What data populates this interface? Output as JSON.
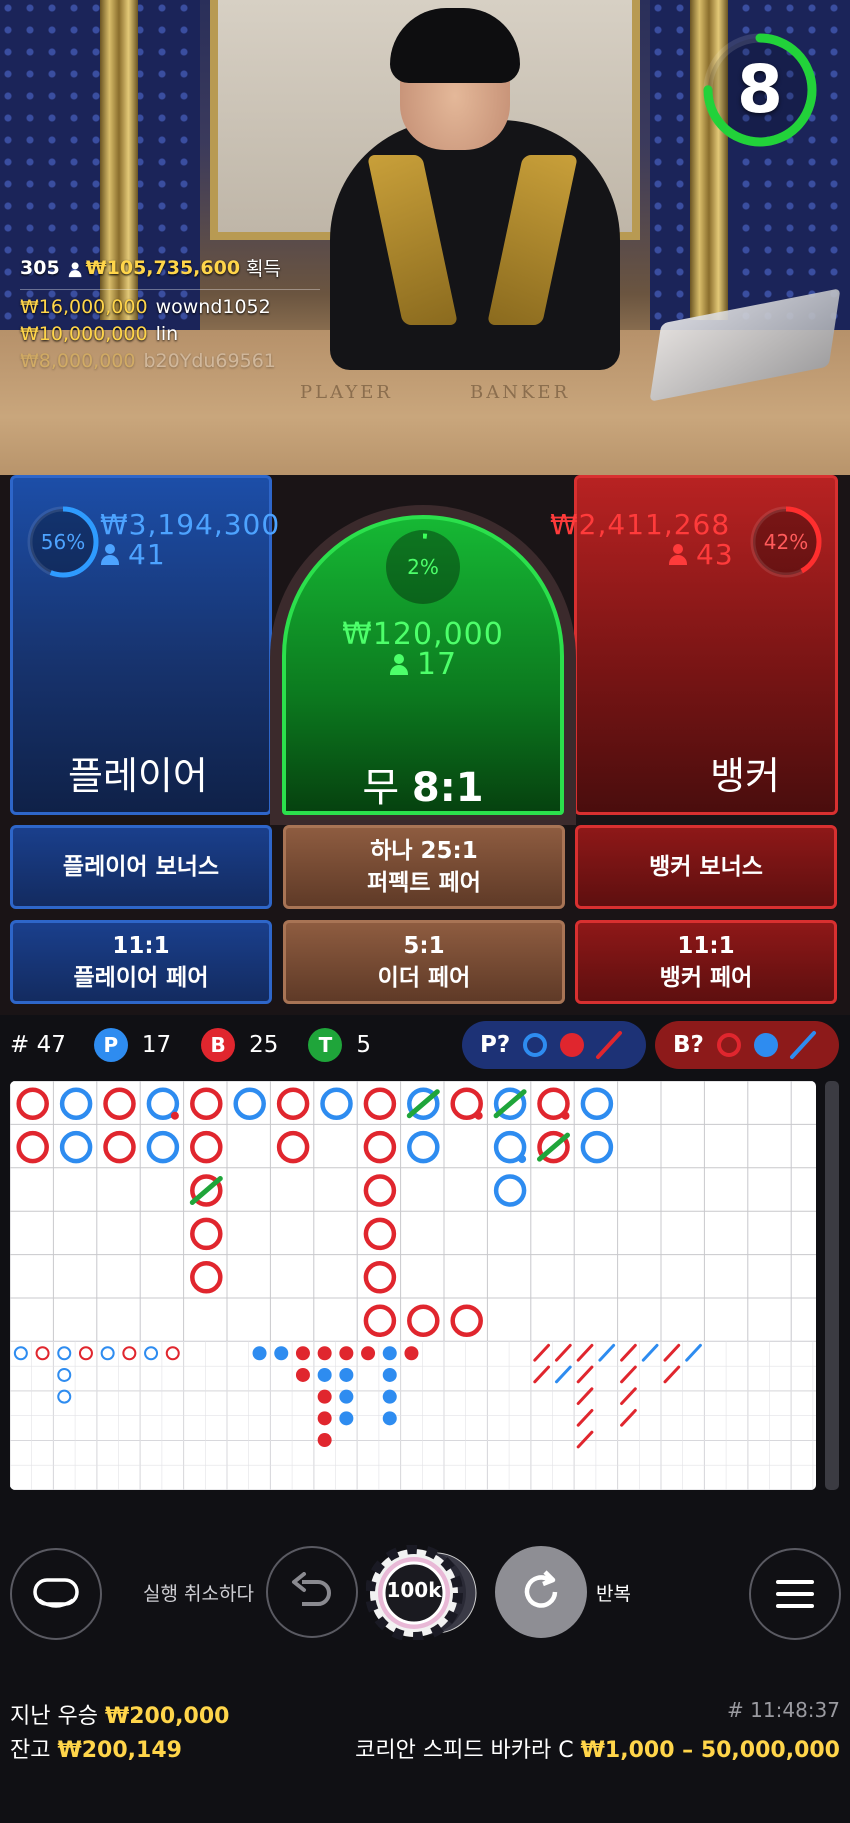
{
  "top_winners": {
    "rank": "305",
    "total": "₩105,735,600",
    "total_label": "획득",
    "rows": [
      {
        "amount": "₩16,000,000",
        "name": "wownd1052"
      },
      {
        "amount": "₩10,000,000",
        "name": "lin"
      },
      {
        "amount": "₩8,000,000",
        "name": "b20Ydu69561"
      }
    ]
  },
  "table_text": {
    "left": "PLAYER",
    "right": "BANKER"
  },
  "timer": {
    "seconds": "8",
    "progress": 0.75,
    "color": "#22d23a"
  },
  "player": {
    "label": "플레이어",
    "amount": "₩3,194,300",
    "users": "41",
    "pct_text": "56%",
    "pct": 0.56,
    "color": "#2e9bff"
  },
  "tie": {
    "label_main": "무",
    "label_odds": "8:1",
    "amount": "₩120,000",
    "users": "17",
    "pct_text": "2%",
    "pct": 0.02,
    "color": "#3cff5a"
  },
  "banker": {
    "label": "뱅커",
    "amount": "₩2,411,268",
    "users": "43",
    "pct_text": "42%",
    "pct": 0.42,
    "color": "#ff2e2e"
  },
  "side_bets": {
    "player_bonus": "플레이어 보너스",
    "perfect_odds": "하나 25:1",
    "perfect_label": "퍼펙트 페어",
    "banker_bonus": "뱅커 보너스",
    "player_pair_odds": "11:1",
    "player_pair_label": "플레이어 페어",
    "either_odds": "5:1",
    "either_label": "이더 페어",
    "banker_pair_odds": "11:1",
    "banker_pair_label": "뱅커 페어"
  },
  "stats": {
    "round": "# 47",
    "p_letter": "P",
    "p_count": "17",
    "b_letter": "B",
    "b_count": "25",
    "t_letter": "T",
    "t_count": "5"
  },
  "predict": {
    "p_label": "P?",
    "b_label": "B?"
  },
  "roadmap": {
    "big_road_cells": [
      {
        "col": 0,
        "row": 0,
        "c": "B"
      },
      {
        "col": 0,
        "row": 1,
        "c": "B"
      },
      {
        "col": 1,
        "row": 0,
        "c": "P"
      },
      {
        "col": 1,
        "row": 1,
        "c": "P"
      },
      {
        "col": 2,
        "row": 0,
        "c": "B"
      },
      {
        "col": 2,
        "row": 1,
        "c": "B"
      },
      {
        "col": 3,
        "row": 0,
        "c": "P",
        "pair": "B"
      },
      {
        "col": 3,
        "row": 1,
        "c": "P"
      },
      {
        "col": 4,
        "row": 0,
        "c": "B"
      },
      {
        "col": 4,
        "row": 1,
        "c": "B"
      },
      {
        "col": 4,
        "row": 2,
        "c": "B",
        "tie": true
      },
      {
        "col": 4,
        "row": 3,
        "c": "B"
      },
      {
        "col": 4,
        "row": 4,
        "c": "B"
      },
      {
        "col": 5,
        "row": 0,
        "c": "P"
      },
      {
        "col": 6,
        "row": 0,
        "c": "B"
      },
      {
        "col": 6,
        "row": 1,
        "c": "B"
      },
      {
        "col": 7,
        "row": 0,
        "c": "P"
      },
      {
        "col": 8,
        "row": 0,
        "c": "B"
      },
      {
        "col": 8,
        "row": 1,
        "c": "B"
      },
      {
        "col": 8,
        "row": 2,
        "c": "B"
      },
      {
        "col": 8,
        "row": 3,
        "c": "B"
      },
      {
        "col": 8,
        "row": 4,
        "c": "B"
      },
      {
        "col": 8,
        "row": 5,
        "c": "B"
      },
      {
        "col": 9,
        "row": 0,
        "c": "P",
        "tie": true
      },
      {
        "col": 9,
        "row": 1,
        "c": "P"
      },
      {
        "col": 9,
        "row": 5,
        "c": "B"
      },
      {
        "col": 10,
        "row": 0,
        "c": "B",
        "pair": "B"
      },
      {
        "col": 10,
        "row": 5,
        "c": "B"
      },
      {
        "col": 11,
        "row": 0,
        "c": "P",
        "tie": true
      },
      {
        "col": 11,
        "row": 1,
        "c": "P",
        "pair": "P"
      },
      {
        "col": 11,
        "row": 2,
        "c": "P"
      },
      {
        "col": 12,
        "row": 0,
        "c": "B",
        "pair": "B"
      },
      {
        "col": 12,
        "row": 1,
        "c": "B",
        "tie": true
      },
      {
        "col": 13,
        "row": 0,
        "c": "P"
      },
      {
        "col": 13,
        "row": 1,
        "c": "P"
      }
    ],
    "big_eye": [
      {
        "col": 0,
        "row": 0,
        "c": "P"
      },
      {
        "col": 1,
        "row": 0,
        "c": "B"
      },
      {
        "col": 2,
        "row": 0,
        "c": "P"
      },
      {
        "col": 2,
        "row": 1,
        "c": "P"
      },
      {
        "col": 2,
        "row": 2,
        "c": "P"
      },
      {
        "col": 3,
        "row": 0,
        "c": "B"
      },
      {
        "col": 4,
        "row": 0,
        "c": "P"
      },
      {
        "col": 5,
        "row": 0,
        "c": "B"
      },
      {
        "col": 6,
        "row": 0,
        "c": "P"
      },
      {
        "col": 7,
        "row": 0,
        "c": "B"
      }
    ],
    "small_road": [
      {
        "col": 0,
        "row": 0,
        "c": "P"
      },
      {
        "col": 1,
        "row": 0,
        "c": "P"
      },
      {
        "col": 2,
        "row": 0,
        "c": "B"
      },
      {
        "col": 2,
        "row": 1,
        "c": "B"
      },
      {
        "col": 3,
        "row": 0,
        "c": "B"
      },
      {
        "col": 3,
        "row": 1,
        "c": "P"
      },
      {
        "col": 3,
        "row": 2,
        "c": "B"
      },
      {
        "col": 3,
        "row": 3,
        "c": "B"
      },
      {
        "col": 3,
        "row": 4,
        "c": "B"
      },
      {
        "col": 4,
        "row": 0,
        "c": "B"
      },
      {
        "col": 4,
        "row": 1,
        "c": "P"
      },
      {
        "col": 4,
        "row": 2,
        "c": "P"
      },
      {
        "col": 4,
        "row": 3,
        "c": "P"
      },
      {
        "col": 5,
        "row": 0,
        "c": "B"
      },
      {
        "col": 6,
        "row": 0,
        "c": "P"
      },
      {
        "col": 6,
        "row": 1,
        "c": "P"
      },
      {
        "col": 6,
        "row": 2,
        "c": "P"
      },
      {
        "col": 6,
        "row": 3,
        "c": "P"
      },
      {
        "col": 7,
        "row": 0,
        "c": "B"
      }
    ],
    "cockroach": [
      {
        "col": 0,
        "row": 0,
        "c": "B"
      },
      {
        "col": 0,
        "row": 1,
        "c": "B"
      },
      {
        "col": 1,
        "row": 0,
        "c": "B"
      },
      {
        "col": 1,
        "row": 1,
        "c": "P"
      },
      {
        "col": 2,
        "row": 0,
        "c": "B"
      },
      {
        "col": 2,
        "row": 1,
        "c": "B"
      },
      {
        "col": 2,
        "row": 2,
        "c": "B"
      },
      {
        "col": 2,
        "row": 3,
        "c": "B"
      },
      {
        "col": 2,
        "row": 4,
        "c": "B"
      },
      {
        "col": 3,
        "row": 0,
        "c": "P"
      },
      {
        "col": 4,
        "row": 0,
        "c": "B"
      },
      {
        "col": 4,
        "row": 1,
        "c": "B"
      },
      {
        "col": 4,
        "row": 2,
        "c": "B"
      },
      {
        "col": 4,
        "row": 3,
        "c": "B"
      },
      {
        "col": 5,
        "row": 0,
        "c": "P"
      },
      {
        "col": 6,
        "row": 0,
        "c": "B"
      },
      {
        "col": 6,
        "row": 1,
        "c": "B"
      },
      {
        "col": 7,
        "row": 0,
        "c": "P"
      }
    ]
  },
  "controls": {
    "undo_label": "실행 취소하다",
    "chip_value": "100k",
    "repeat_label": "반복"
  },
  "footer": {
    "last_win_label": "지난 우승",
    "last_win_amount": "₩200,000",
    "balance_label": "잔고",
    "balance_amount": "₩200,149",
    "time": "# 11:48:37",
    "table_name": "코리안 스피드 바카라 C",
    "limits": "₩1,000 – 50,000,000"
  },
  "colors": {
    "player": "#2e8cf0",
    "banker": "#e0262e",
    "tie": "#1fa53a",
    "gold": "#ffd54a"
  }
}
